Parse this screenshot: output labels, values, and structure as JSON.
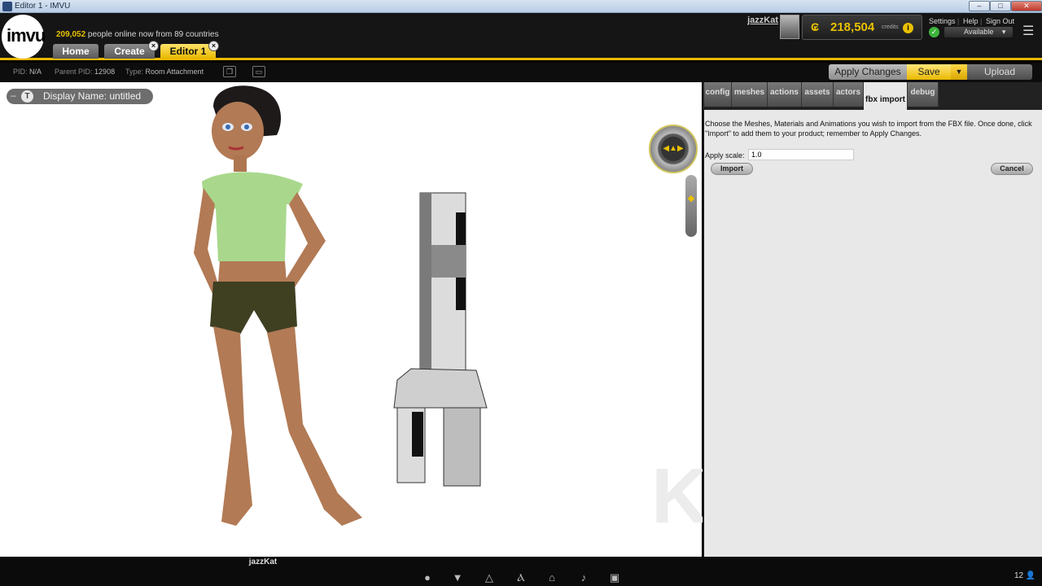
{
  "window": {
    "title": "Editor 1 - IMVU",
    "min": "–",
    "max": "□",
    "close": "✕"
  },
  "header": {
    "logo": "imvu",
    "online_count": "209,052",
    "online_text": " people online now from 89 countries",
    "tabs": [
      {
        "label": "Home"
      },
      {
        "label": "Create"
      },
      {
        "label": "Editor 1"
      }
    ],
    "username": "jazzKat",
    "credits_value": "218,504",
    "credits_label": "credits",
    "links": {
      "settings": "Settings",
      "help": "Help",
      "signout": "Sign Out"
    },
    "status": "Available"
  },
  "infobar": {
    "pid_label": "PID:",
    "pid": "N/A",
    "parent_label": "Parent PID:",
    "parent": "12908",
    "type_label": "Type:",
    "type": "Room Attachment"
  },
  "actions": {
    "apply": "Apply Changes",
    "save": "Save",
    "save_menu": "▼",
    "upload": "Upload"
  },
  "viewport": {
    "display_name": "Display Name: untitled",
    "watermark": "KatsBits",
    "avatar_name": "jazzKat"
  },
  "panel": {
    "tabs": [
      {
        "label": "config"
      },
      {
        "label": "meshes"
      },
      {
        "label": "actions"
      },
      {
        "label": "assets"
      },
      {
        "label": "actors"
      },
      {
        "label": "fbx import"
      },
      {
        "label": "debug"
      }
    ],
    "description": "Choose the Meshes, Materials and Animations you wish to import from the FBX file. Once done, click \"Import\" to add them to your product; remember to Apply Changes.",
    "scale_label": "Apply scale:",
    "scale_value": "1.0",
    "import_label": "Import",
    "cancel_label": "Cancel"
  },
  "bottom": {
    "people_count": "12"
  },
  "colors": {
    "accent": "#e9b800",
    "panel_bg": "#e8e8e8",
    "header_bg": "#151515"
  }
}
